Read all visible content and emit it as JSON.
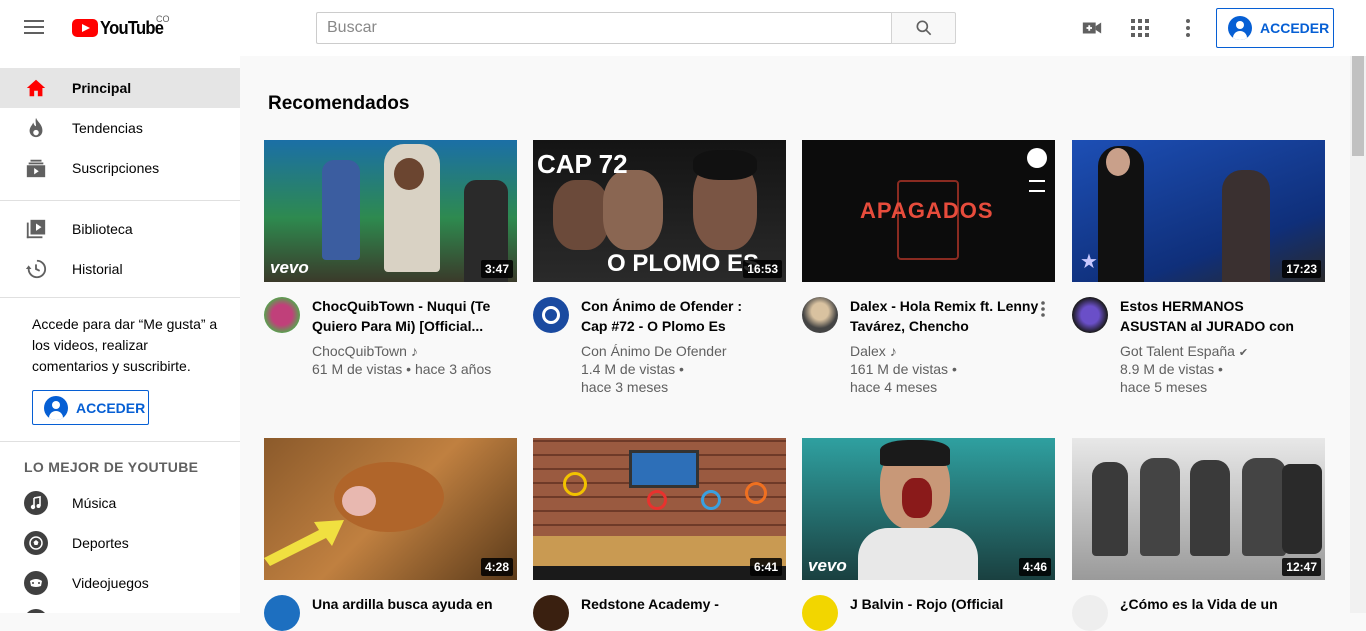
{
  "header": {
    "logo_text": "YouTube",
    "logo_country": "CO",
    "search_placeholder": "Buscar",
    "signin_label": "ACCEDER"
  },
  "sidebar": {
    "main_items": [
      {
        "label": "Principal",
        "icon": "home-icon"
      },
      {
        "label": "Tendencias",
        "icon": "fire-icon"
      },
      {
        "label": "Suscripciones",
        "icon": "subscriptions-icon"
      }
    ],
    "library_items": [
      {
        "label": "Biblioteca",
        "icon": "library-icon"
      },
      {
        "label": "Historial",
        "icon": "history-icon"
      }
    ],
    "signin_prompt": "Accede para dar “Me gusta” a los videos, realizar comentarios y suscribirte.",
    "signin_label": "ACCEDER",
    "best_of_title": "LO MEJOR DE YOUTUBE",
    "best_of_items": [
      {
        "label": "Música",
        "icon": "music-icon"
      },
      {
        "label": "Deportes",
        "icon": "sports-icon"
      },
      {
        "label": "Videojuegos",
        "icon": "gaming-icon"
      }
    ]
  },
  "main": {
    "section_title": "Recomendados",
    "videos": [
      {
        "title": "ChocQuibTown - Nuqui (Te Quiero Para Mi) [Official...",
        "channel": "ChocQuibTown",
        "music_note": "♪",
        "views": "61 M de vistas • hace 3 años",
        "views2": "",
        "duration": "3:47",
        "thumb_text": "vevo",
        "accent": "#2a6fa8"
      },
      {
        "title": "Con Ánimo de Ofender : Cap #72 - O Plomo Es",
        "channel": "Con Ánimo De Ofender",
        "music_note": "",
        "views": "1.4 M de vistas •",
        "views2": "hace 3 meses",
        "duration": "16:53",
        "thumb_text": "CAP 72",
        "thumb_text2": "O PLOMO ES",
        "accent": "#1a1a1a"
      },
      {
        "title": "Dalex - Hola Remix ft. Lenny Tavárez, Chencho Corleone...",
        "channel": "Dalex",
        "music_note": "♪",
        "views": "161 M de vistas •",
        "views2": "hace 4 meses",
        "duration": "",
        "thumb_text": "APAGADOS",
        "accent": "#0d0d0d"
      },
      {
        "title": "Estos HERMANOS ASUSTAN al JURADO con su MAGIA...",
        "channel": "Got Talent España",
        "music_note": "✔",
        "views": "8.9 M de vistas •",
        "views2": "hace 5 meses",
        "duration": "17:23",
        "thumb_text": "",
        "accent": "#1e4fa0"
      },
      {
        "title": "Una ardilla busca ayuda en",
        "channel": "",
        "music_note": "",
        "views": "",
        "views2": "",
        "duration": "4:28",
        "thumb_text": "",
        "accent": "#8b5a2b"
      },
      {
        "title": "Redstone Academy -",
        "channel": "",
        "music_note": "",
        "views": "",
        "views2": "",
        "duration": "6:41",
        "thumb_text": "",
        "accent": "#a0522d"
      },
      {
        "title": "J Balvin - Rojo (Official",
        "channel": "",
        "music_note": "",
        "views": "",
        "views2": "",
        "duration": "4:46",
        "thumb_text": "vevo",
        "accent": "#2fa0a0"
      },
      {
        "title": "¿Cómo es la Vida de un",
        "channel": "",
        "music_note": "",
        "views": "",
        "views2": "",
        "duration": "12:47",
        "thumb_text": "",
        "accent": "#888888"
      }
    ]
  }
}
